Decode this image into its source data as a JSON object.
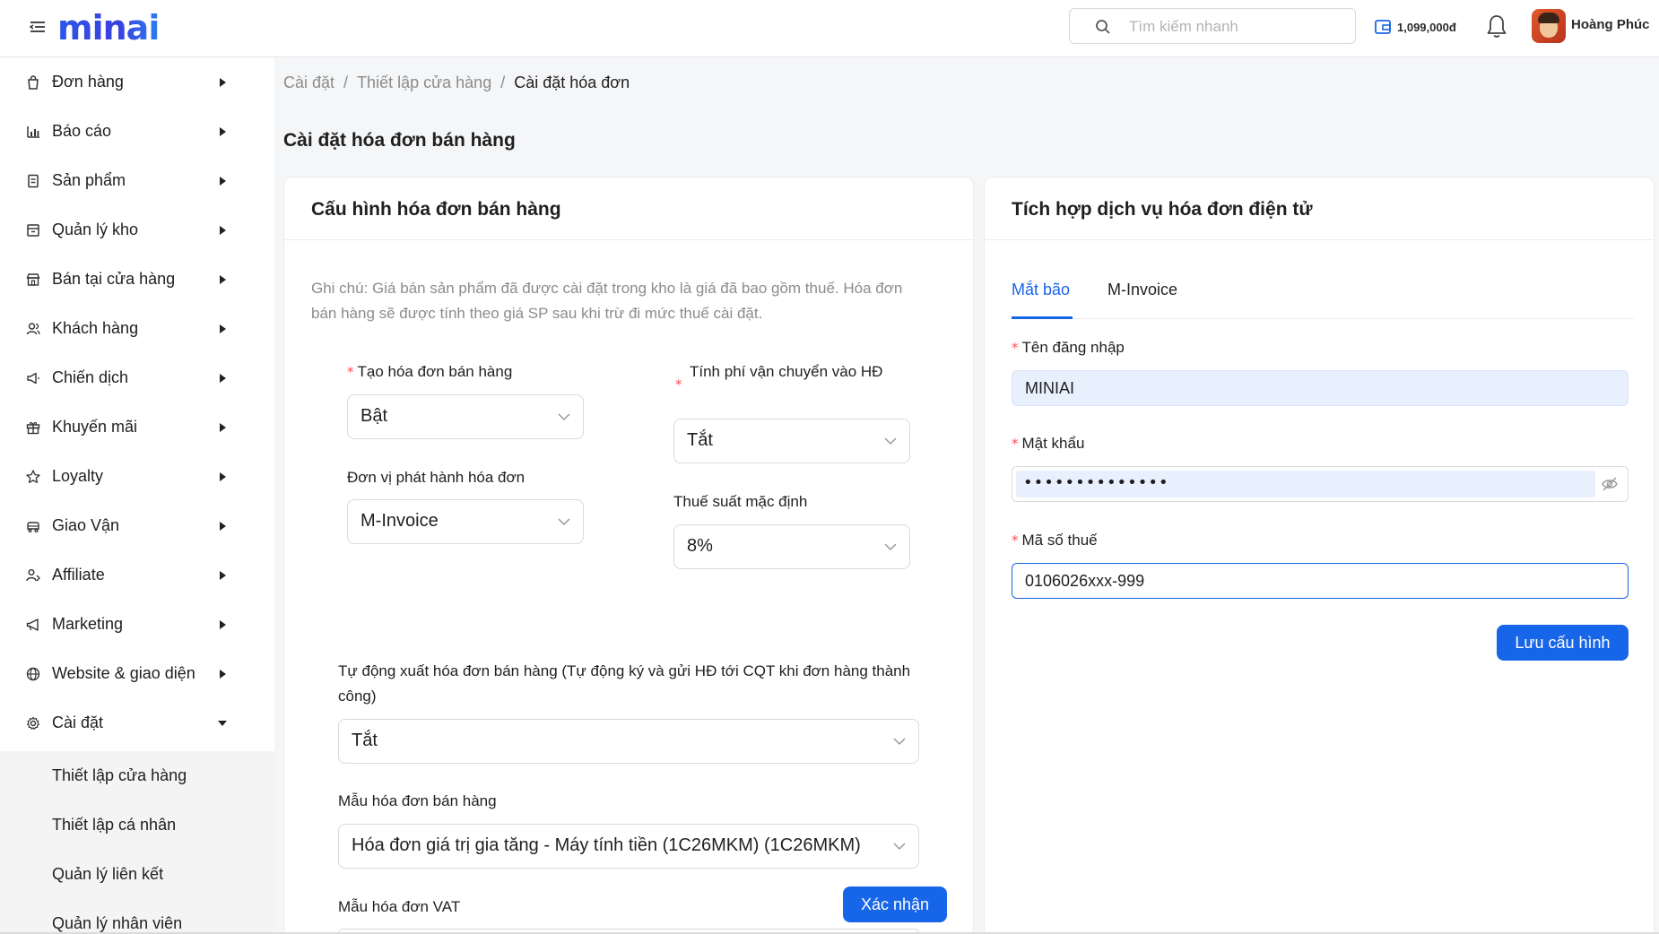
{
  "header": {
    "logo_text": "minai",
    "search_placeholder": "Tìm kiếm nhanh",
    "wallet_amount": "1,099,000đ",
    "user_name": "Hoàng Phúc"
  },
  "sidebar": {
    "items": [
      {
        "label": "Đơn hàng",
        "icon": "bag-icon"
      },
      {
        "label": "Báo cáo",
        "icon": "bar-chart-icon"
      },
      {
        "label": "Sản phẩm",
        "icon": "product-icon"
      },
      {
        "label": "Quản lý kho",
        "icon": "warehouse-icon"
      },
      {
        "label": "Bán tại cửa hàng",
        "icon": "store-icon"
      },
      {
        "label": "Khách hàng",
        "icon": "users-icon"
      },
      {
        "label": "Chiến dịch",
        "icon": "campaign-icon"
      },
      {
        "label": "Khuyến mãi",
        "icon": "gift-icon"
      },
      {
        "label": "Loyalty",
        "icon": "star-icon"
      },
      {
        "label": "Giao Vận",
        "icon": "truck-icon"
      },
      {
        "label": "Affiliate",
        "icon": "affiliate-icon"
      },
      {
        "label": "Marketing",
        "icon": "megaphone-icon"
      },
      {
        "label": "Website & giao diện",
        "icon": "globe-icon"
      },
      {
        "label": "Cài đặt",
        "icon": "gear-icon"
      }
    ],
    "sub_items": [
      {
        "label": "Thiết lập cửa hàng"
      },
      {
        "label": "Thiết lập cá nhân"
      },
      {
        "label": "Quản lý liên kết"
      },
      {
        "label": "Quản lý nhân viên"
      }
    ]
  },
  "breadcrumb": {
    "items": [
      "Cài đặt",
      "Thiết lập cửa hàng",
      "Cài đặt hóa đơn"
    ],
    "separator": "/"
  },
  "page_title": "Cài đặt hóa đơn bán hàng",
  "config_card": {
    "title": "Cấu hình hóa đơn bán hàng",
    "note": "Ghi chú: Giá bán sản phẩm đã được cài đặt trong kho là giá đã bao gồm thuế. Hóa đơn bán hàng sẽ được tính theo giá SP sau khi trừ đi mức thuế cài đặt.",
    "create_invoice": {
      "label": "Tạo hóa đơn bán hàng",
      "value": "Bật",
      "required": true
    },
    "shipping_fee": {
      "label": "Tính phí vận chuyển vào HĐ",
      "value": "Tắt",
      "required": true
    },
    "issuer": {
      "label": "Đơn vị phát hành hóa đơn",
      "value": "M-Invoice"
    },
    "default_tax": {
      "label": "Thuế suất mặc định",
      "value": "8%"
    },
    "auto_export": {
      "label": "Tự động xuất hóa đơn bán hàng (Tự động ký và gửi HĐ tới CQT khi đơn hàng thành công)",
      "value": "Tắt"
    },
    "invoice_template": {
      "label": "Mẫu hóa đơn bán hàng",
      "value": "Hóa đơn giá trị gia tăng - Máy tính tiền (1C26MKM) (1C26MKM)"
    },
    "vat_template": {
      "label": "Mẫu hóa đơn VAT"
    },
    "confirm_label": "Xác nhận"
  },
  "integration_card": {
    "title": "Tích hợp dịch vụ hóa đơn điện tử",
    "tabs": [
      "Mắt bão",
      "M-Invoice"
    ],
    "active_tab": "Mắt bão",
    "username": {
      "label": "Tên đăng nhập",
      "value": "MINIAI"
    },
    "password": {
      "label": "Mật khẩu",
      "masked": "••••••••••••••"
    },
    "tax_code": {
      "label": "Mã số thuế",
      "value": "0106026xxx-999"
    },
    "save_label": "Lưu cấu hình"
  },
  "colors": {
    "primary": "#1765e8",
    "required": "#ff4d4f",
    "autofill": "#e8f0fe"
  }
}
